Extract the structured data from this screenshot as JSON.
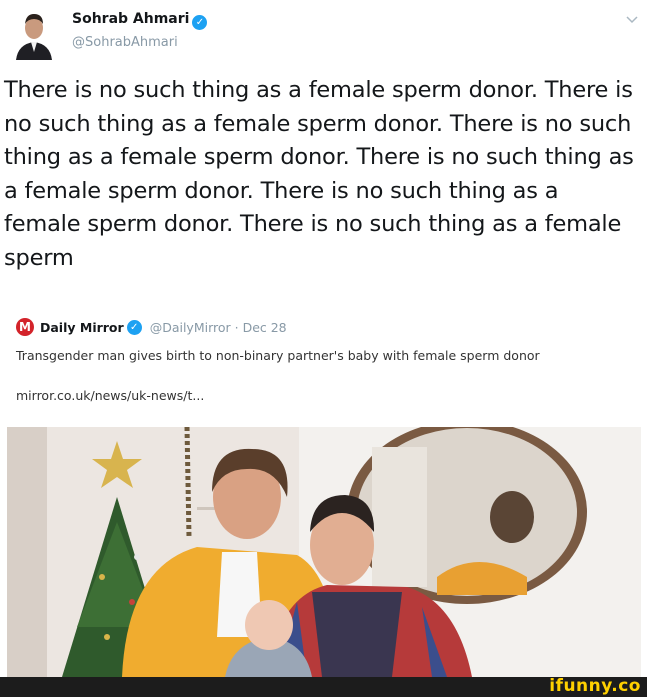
{
  "author": {
    "display_name": "Sohrab Ahmari",
    "handle": "@SohrabAhmari",
    "verified": true
  },
  "tweet": {
    "text": "There is no such thing as a female sperm donor. There is no such thing as a female sperm donor. There is no such thing as a female sperm donor. There is no such thing as a female sperm donor. There is no such thing as a female sperm donor. There is no such thing as a female sperm"
  },
  "quoted": {
    "logo_letter": "M",
    "source_name": "Daily Mirror",
    "source_meta": "@DailyMirror · Dec 28",
    "headline": "Transgender man gives birth to non-binary partner's baby with female sperm donor",
    "link": "mirror.co.uk/news/uk-news/t..."
  },
  "watermark": "ifunny.co",
  "icons": {
    "verified": "verified-badge-icon",
    "caret": "chevron-down-icon",
    "logo": "daily-mirror-logo"
  },
  "colors": {
    "verified_blue": "#1da1f2",
    "handle_gray": "#8899a6",
    "mirror_red": "#d3232a",
    "watermark_yellow": "#ffd100"
  }
}
